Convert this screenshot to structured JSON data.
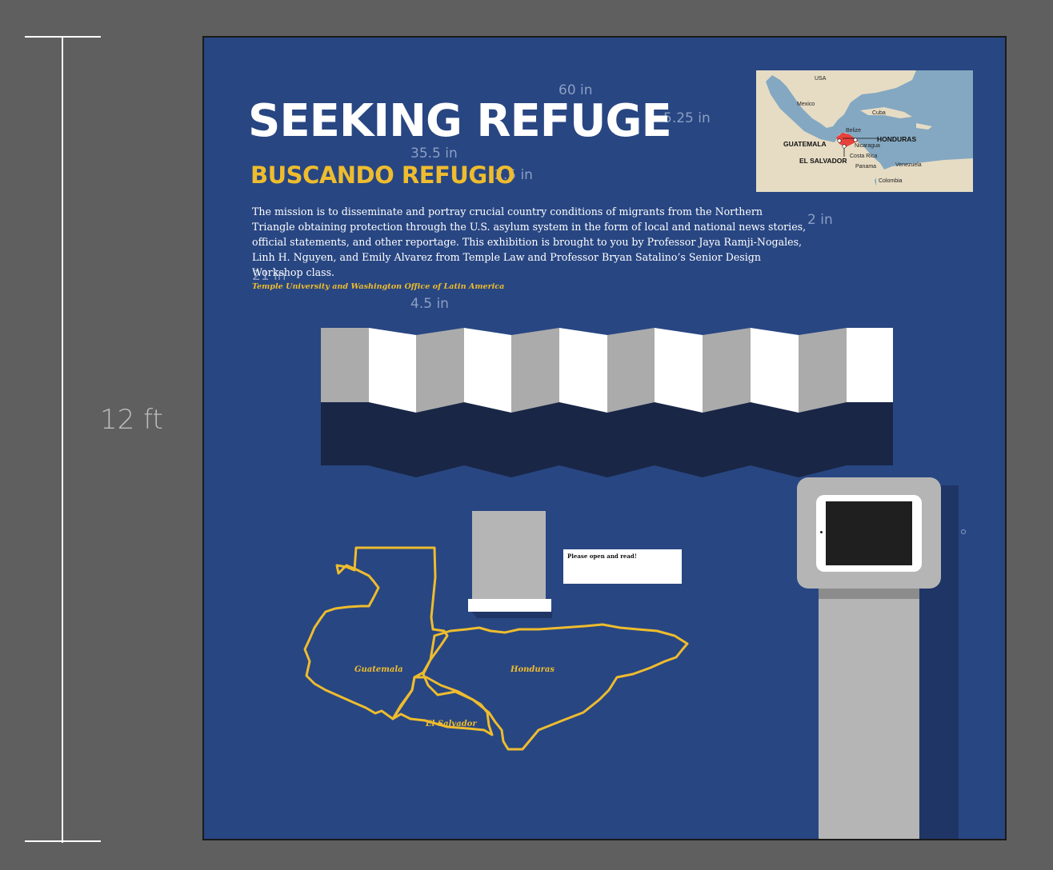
{
  "scale": {
    "height_label": "12 ft"
  },
  "dimensions": {
    "width_60": "60 in",
    "height_525": "5.25 in",
    "width_355": "35.5 in",
    "height_25": "2.5 in",
    "height_2": "2 in",
    "width_21": "21 in",
    "height_45": "4.5 in"
  },
  "header": {
    "title": "SEEKING REFUGE",
    "subtitle": "BUSCANDO REFUGIO"
  },
  "mission": {
    "text": "The mission is to disseminate and portray crucial country conditions of migrants from the Northern Triangle obtaining protection through the U.S. asylum system in the form of local and national news stories, official statements, and other reportage. This exhibition is brought to you by Professor Jaya Ramji-Nogales, Linh H. Nguyen, and Emily Alvarez from Temple Law and Professor Bryan Satalino’s Senior Design Workshop class.",
    "credit": "Temple University and Washington Office of Latin America"
  },
  "region_map": {
    "labels": {
      "usa": "USA",
      "mexico": "Mexico",
      "cuba": "Cuba",
      "belize": "Belize",
      "guatemala": "GUATEMALA",
      "honduras": "HONDURAS",
      "nicaragua": "Nicaragua",
      "el_salvador": "EL SALVADOR",
      "costa_rica": "Costa Rica",
      "panama": "Panama",
      "venezuela": "Venezuela",
      "colombia": "Colombia"
    },
    "colors": {
      "water": "#84a8c1",
      "land": "#e6dcc4",
      "highlight": "#e8413a"
    }
  },
  "outline_map": {
    "labels": {
      "guatemala": "Guatemala",
      "honduras": "Honduras",
      "el_salvador": "El Salvador"
    },
    "stroke_color": "#eebc2e"
  },
  "brochure": {
    "note": "Please open and read!"
  },
  "colors": {
    "board": "#284682",
    "accent_yellow": "#eebc2e",
    "background": "#5f5f5f",
    "fold_gray": "#ababab",
    "fold_white": "#ffffff",
    "shadow_navy": "#192646",
    "screen": "#1f1f1f"
  },
  "icons": {
    "tablet_kiosk": "tablet-kiosk-icon",
    "brochure_holder": "brochure-holder-icon"
  }
}
